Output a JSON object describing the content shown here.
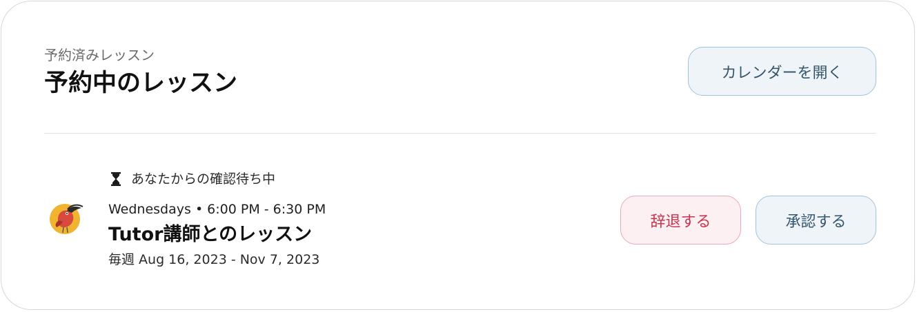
{
  "header": {
    "subtitle": "予約済みレッスン",
    "title": "予約中のレッスン",
    "calendar_button_label": "カレンダーを開く"
  },
  "lesson": {
    "status_icon": "hourglass-icon",
    "status_text": "あなたからの確認待ち中",
    "avatar_icon": "toucan-bird-avatar",
    "schedule": "Wednesdays • 6:00 PM - 6:30 PM",
    "name": "Tutor講師とのレッスン",
    "date_range": "毎週 Aug 16, 2023 - Nov 7, 2023",
    "decline_label": "辞退する",
    "approve_label": "承認する"
  },
  "colors": {
    "decline_text": "#c8344f",
    "decline_border": "#eba7b5",
    "decline_bg": "#fcf0f2",
    "primary_text": "#35566b",
    "primary_border": "#9fc3da",
    "primary_bg": "#eef4f8",
    "avatar_bg": "#f0b431",
    "bird_body": "#d94a3d"
  }
}
